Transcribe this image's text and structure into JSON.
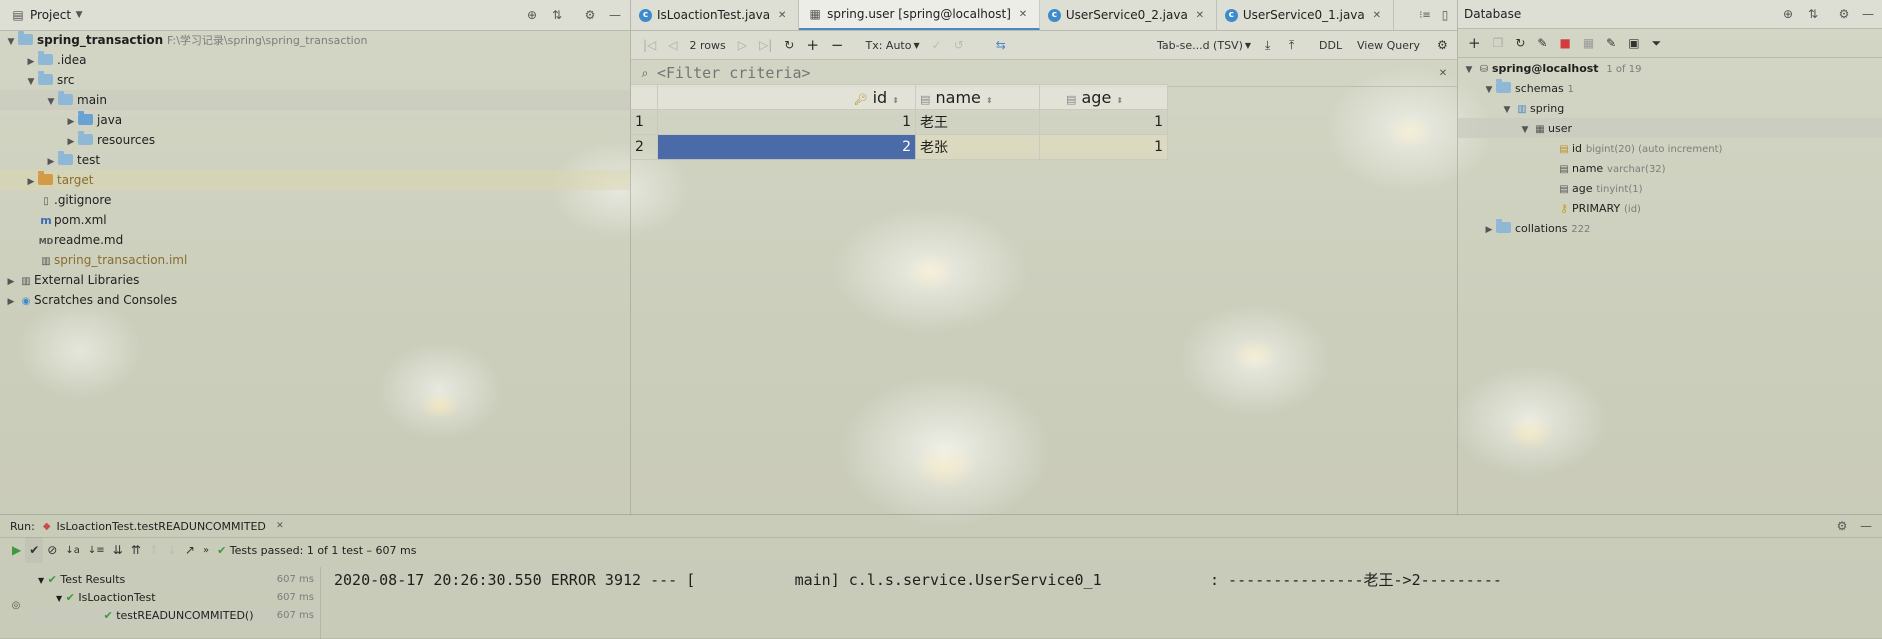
{
  "project": {
    "title": "Project",
    "tree": [
      {
        "label": "spring_transaction",
        "path": "F:\\学习记录\\spring\\spring_transaction"
      },
      {
        "label": ".idea"
      },
      {
        "label": "src"
      },
      {
        "label": "main"
      },
      {
        "label": "java"
      },
      {
        "label": "resources"
      },
      {
        "label": "test"
      },
      {
        "label": "target"
      },
      {
        "label": ".gitignore"
      },
      {
        "label": "pom.xml"
      },
      {
        "label": "readme.md"
      },
      {
        "label": "spring_transaction.iml"
      },
      {
        "label": "External Libraries"
      },
      {
        "label": "Scratches and Consoles"
      }
    ]
  },
  "tabs": [
    {
      "label": "IsLoactionTest.java"
    },
    {
      "label": "spring.user [spring@localhost]"
    },
    {
      "label": "UserService0_2.java"
    },
    {
      "label": "UserService0_1.java"
    }
  ],
  "toolbar": {
    "rows": "2 rows",
    "tx": "Tx: Auto",
    "format": "Tab-se...d (TSV)",
    "ddl": "DDL",
    "view_query": "View Query",
    "filter_placeholder": "<Filter criteria>"
  },
  "grid": {
    "columns": [
      "id",
      "name",
      "age"
    ],
    "rows": [
      {
        "num": "1",
        "id": "1",
        "name": "老王",
        "age": "1"
      },
      {
        "num": "2",
        "id": "2",
        "name": "老张",
        "age": "1"
      }
    ]
  },
  "database": {
    "title": "Database",
    "host": "spring@localhost",
    "host_count": "1 of 19",
    "schemas": "schemas",
    "schemas_count": "1",
    "schema": "spring",
    "table": "user",
    "cols": [
      {
        "name": "id",
        "type": "bigint(20) (auto increment)"
      },
      {
        "name": "name",
        "type": "varchar(32)"
      },
      {
        "name": "age",
        "type": "tinyint(1)"
      },
      {
        "name": "PRIMARY",
        "type": "(id)"
      }
    ],
    "collations": "collations",
    "collations_count": "222"
  },
  "run": {
    "label": "Run:",
    "config": "IsLoactionTest.testREADUNCOMMITED",
    "status_prefix": "Tests passed:",
    "status_count": "1",
    "status_suffix": "of 1 test – 607 ms",
    "results": [
      {
        "label": "Test Results",
        "time": "607 ms"
      },
      {
        "label": "IsLoactionTest",
        "time": "607 ms"
      },
      {
        "label": "testREADUNCOMMITED()",
        "time": "607 ms"
      }
    ],
    "console": "2020-08-17 20:26:30.550 ERROR 3912 --- [           main] c.l.s.service.UserService0_1            : ---------------老王->2---------"
  }
}
